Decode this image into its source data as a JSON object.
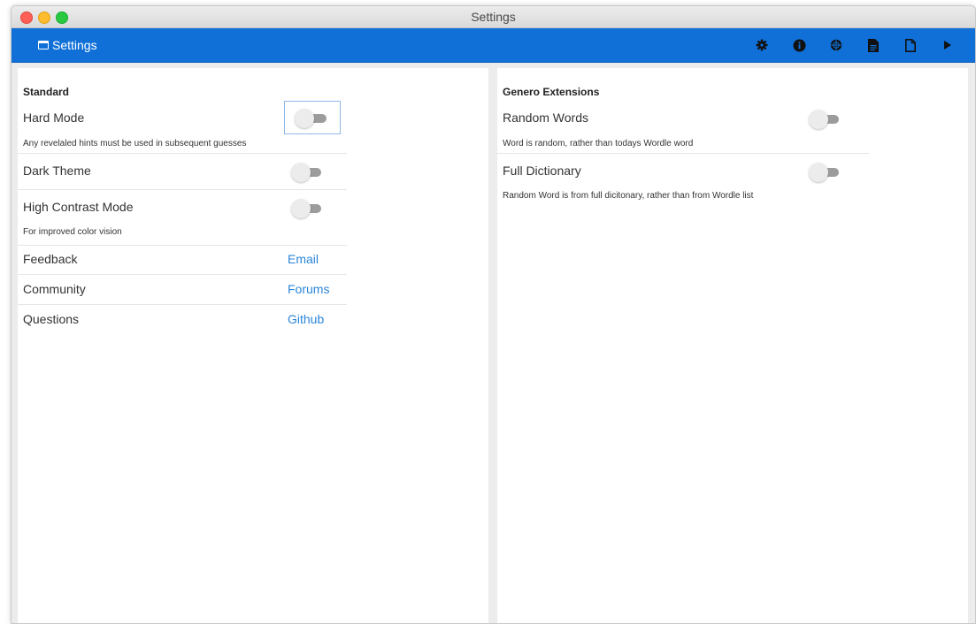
{
  "window": {
    "title": "Settings"
  },
  "toolbar": {
    "title": "Settings",
    "icons": [
      "gear-icon",
      "info-icon",
      "globe-icon",
      "document-icon",
      "blank-page-icon",
      "play-icon"
    ],
    "background": "#1070d8"
  },
  "standard": {
    "title": "Standard",
    "hard_mode": {
      "label": "Hard Mode",
      "desc": "Any revelaled hints must be used in subsequent guesses",
      "enabled": false
    },
    "dark_theme": {
      "label": "Dark Theme",
      "enabled": false
    },
    "high_contrast": {
      "label": "High Contrast Mode",
      "desc": "For improved color vision",
      "enabled": false
    },
    "feedback": {
      "label": "Feedback",
      "link": "Email"
    },
    "community": {
      "label": "Community",
      "link": "Forums"
    },
    "questions": {
      "label": "Questions",
      "link": "Github"
    }
  },
  "extensions": {
    "title": "Genero Extensions",
    "random_words": {
      "label": "Random Words",
      "desc": "Word is random, rather than todays Wordle word",
      "enabled": false
    },
    "full_dictionary": {
      "label": "Full Dictionary",
      "desc": "Random Word is from full dicitonary, rather than from Wordle list",
      "enabled": false
    }
  },
  "colors": {
    "link": "#2b86d8",
    "toggle_off": "#9c9c9c"
  }
}
